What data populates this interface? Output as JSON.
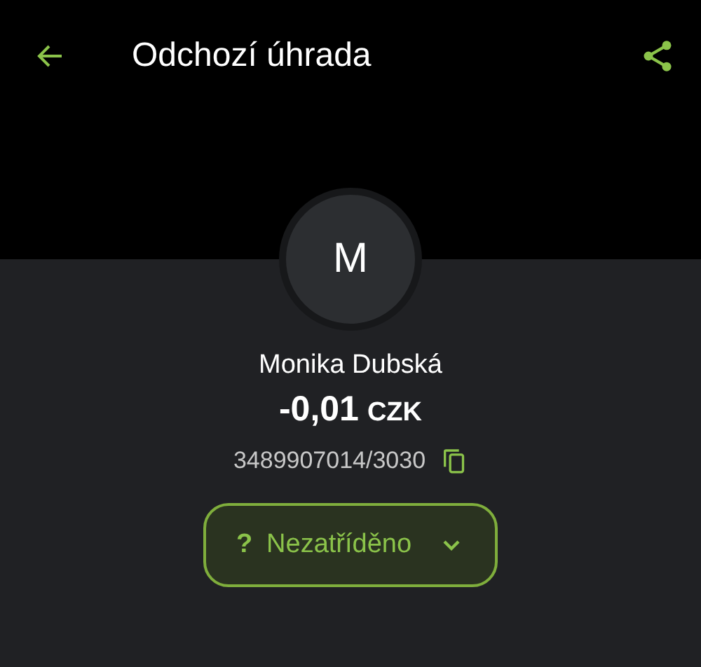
{
  "app_bar": {
    "title": "Odchozí úhrada"
  },
  "counterparty": {
    "avatar_letter": "M",
    "name": "Monika Dubská"
  },
  "amount": {
    "value": "-0,01",
    "currency": "CZK"
  },
  "account": "3489907014/3030",
  "category": {
    "icon": "?",
    "label": "Nezatříděno"
  }
}
